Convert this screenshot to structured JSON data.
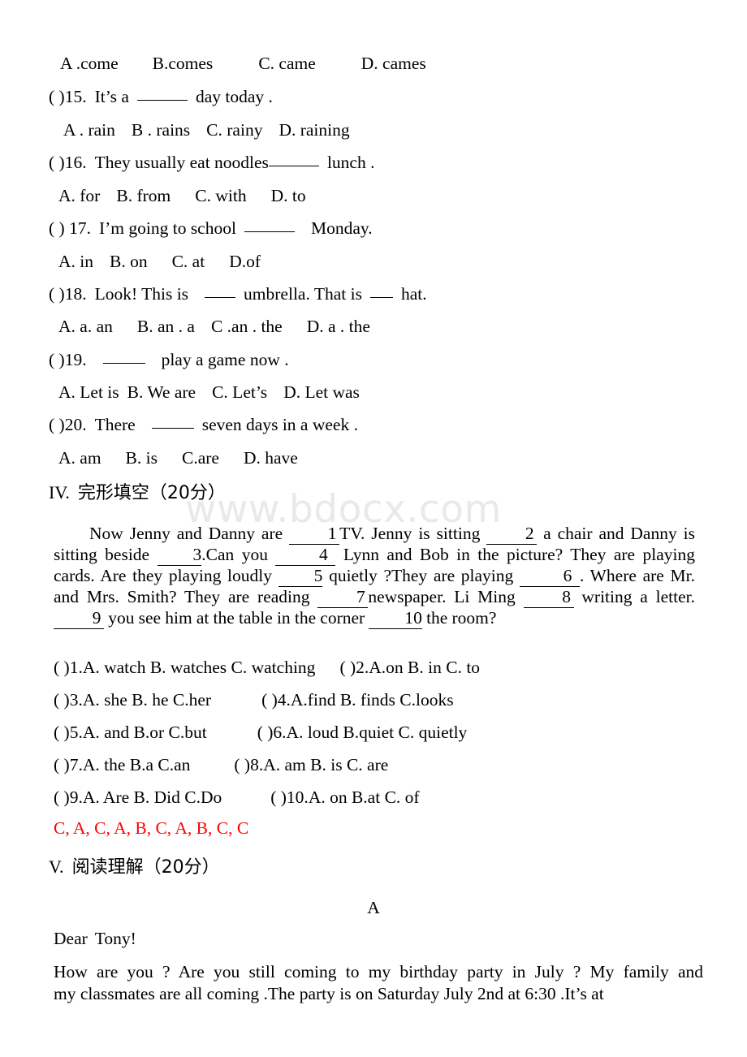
{
  "document": {
    "watermark": "www.bdocx.com",
    "answer_key_color": "#ff0000",
    "text_color": "#000000"
  },
  "grammar_questions": {
    "q14_options": {
      "a": "A .come",
      "b": "B.comes",
      "c": "C. came",
      "d": "D. cames"
    },
    "q15": {
      "marker": "(  )15.",
      "text_before": "It’s a",
      "text_after": "day today .",
      "options": {
        "a": "A . rain",
        "b": "B . rains",
        "c": "C.  rainy",
        "d": "D.  raining"
      }
    },
    "q16": {
      "marker": "(  )16.",
      "text_before": "They usually eat noodles",
      "text_after": "lunch .",
      "options": {
        "a": "A. for",
        "b": "B. from",
        "c": "C. with",
        "d": "D. to"
      }
    },
    "q17": {
      "marker": "(  ) 17.",
      "text_before": "I’m going to school",
      "text_after": "Monday.",
      "options": {
        "a": "A. in",
        "b": "B. on",
        "c": "C. at",
        "d": "D.of"
      }
    },
    "q18": {
      "marker": "(  )18.",
      "text_before": "Look! This is",
      "text_middle": "umbrella.  That is",
      "text_after": "hat.",
      "options": {
        "a": "A. a. an",
        "b": "B. an . a",
        "c": "C .an . the",
        "d": "D. a . the"
      }
    },
    "q19": {
      "marker": "(  )19.",
      "text_before": "",
      "text_after": "play a game now .",
      "options": {
        "a": "A. Let  is",
        "b": "B. We  are",
        "c": "C. Let’s",
        "d": "D. Let  was"
      }
    },
    "q20": {
      "marker": "(  )20.",
      "text_before": "There",
      "text_after": "seven days in a week .",
      "options": {
        "a": "A. am",
        "b": "B. is",
        "c": "C.are",
        "d": "D. have"
      }
    }
  },
  "cloze_section": {
    "heading_roman": "IV.",
    "heading_title": "完形填空",
    "heading_points": "（20分）",
    "passage": {
      "s1a": "Now Jenny and Danny are",
      "n1": "1",
      "s1b": "TV. Jenny is sitting",
      "n2": "2",
      "s1c": "a chair and Danny is sitting beside",
      "n3": "3",
      "s1d": ".Can you",
      "n4": "4",
      "s1e": "Lynn and Bob in the picture? They are playing cards. Are they playing loudly",
      "n5": "5",
      "s1f": "quietly ?They are playing",
      "n6": "6",
      "s1g": ". Where are Mr. and Mrs. Smith? They are reading",
      "n7": "7",
      "s1h": "newspaper.  Li Ming",
      "n8": "8",
      "s1i": "writing a letter.",
      "n9": "9",
      "s1j": "you see him at the table in the corner",
      "n10": "10",
      "s1k": "the room?"
    },
    "options": [
      {
        "marker": "(  )1.",
        "text": "A. watch B. watches C. watching"
      },
      {
        "marker": "(  )2.",
        "text": "A.on   B. in    C. to"
      },
      {
        "marker": "(  )3.",
        "text": "A. she  B. he     C.her"
      },
      {
        "marker": "(  )4.",
        "text": "A.find  B. finds  C.looks"
      },
      {
        "marker": "(  )5.",
        "text": "A. and  B.or     C.but"
      },
      {
        "marker": "(  )6.",
        "text": "A. loud  B.quiet  C. quietly"
      },
      {
        "marker": "(  )7.",
        "text": "A. the  B.a       C.an"
      },
      {
        "marker": "(  )8.",
        "text": "A. am   B. is    C. are"
      },
      {
        "marker": "(  )9.",
        "text": "A. Are  B. Did   C.Do"
      },
      {
        "marker": "(  )10.",
        "text": "A. on   B.at    C. of"
      }
    ],
    "answer_key": "C, A, C, A, B, C, A, B, C, C"
  },
  "reading_section": {
    "heading_roman": "V.",
    "heading_title": "阅读理解",
    "heading_points": "（20分）",
    "passage_label": "A",
    "salutation": "Dear  Tony!",
    "letter_line1": "How  are  you ? Are  you  still  coming  to  my  birthday  party  in  July ? My  family  and",
    "letter_line2": "my  classmates  are  all  coming .The  party  is  on  Saturday  July  2nd  at  6:30 .It’s  at"
  }
}
